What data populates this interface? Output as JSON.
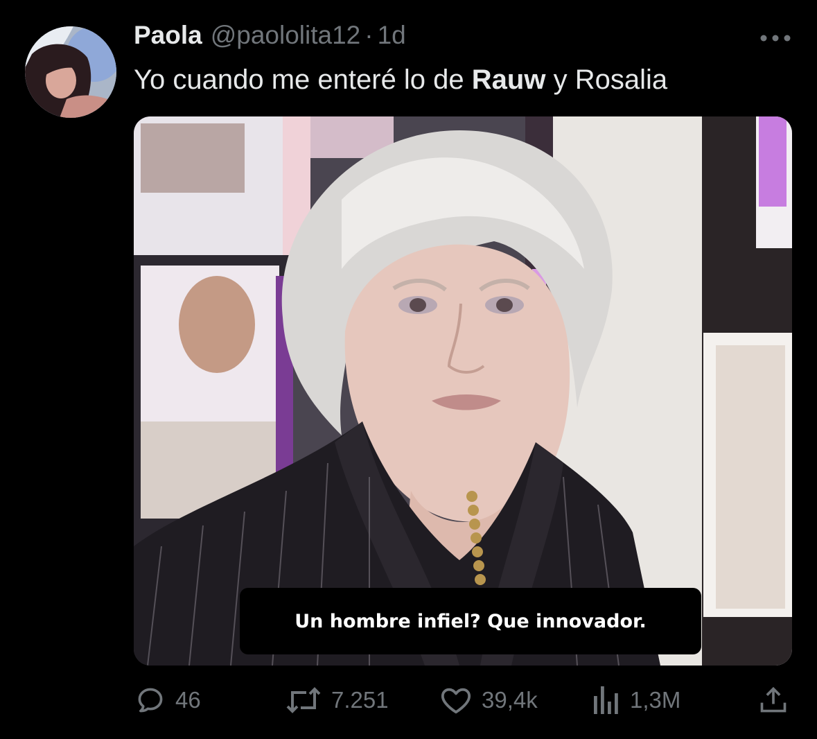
{
  "tweet": {
    "display_name": "Paola",
    "handle": "@paololita12",
    "separator": "·",
    "time": "1d",
    "text_before": "Yo cuando me enteré lo de ",
    "text_bold": "Rauw",
    "text_after": " y Rosalia",
    "media_caption": "Un hombre infiel? Que innovador."
  },
  "actions": {
    "replies": "46",
    "reposts": "7.251",
    "likes": "39,4k",
    "views": "1,3M"
  },
  "icons": {
    "more": "more-horizontal-icon",
    "reply": "reply-icon",
    "repost": "repost-icon",
    "like": "heart-icon",
    "views": "views-icon",
    "share": "share-icon"
  },
  "colors": {
    "background": "#000000",
    "text_primary": "#e7e9ea",
    "text_secondary": "#71767b"
  }
}
